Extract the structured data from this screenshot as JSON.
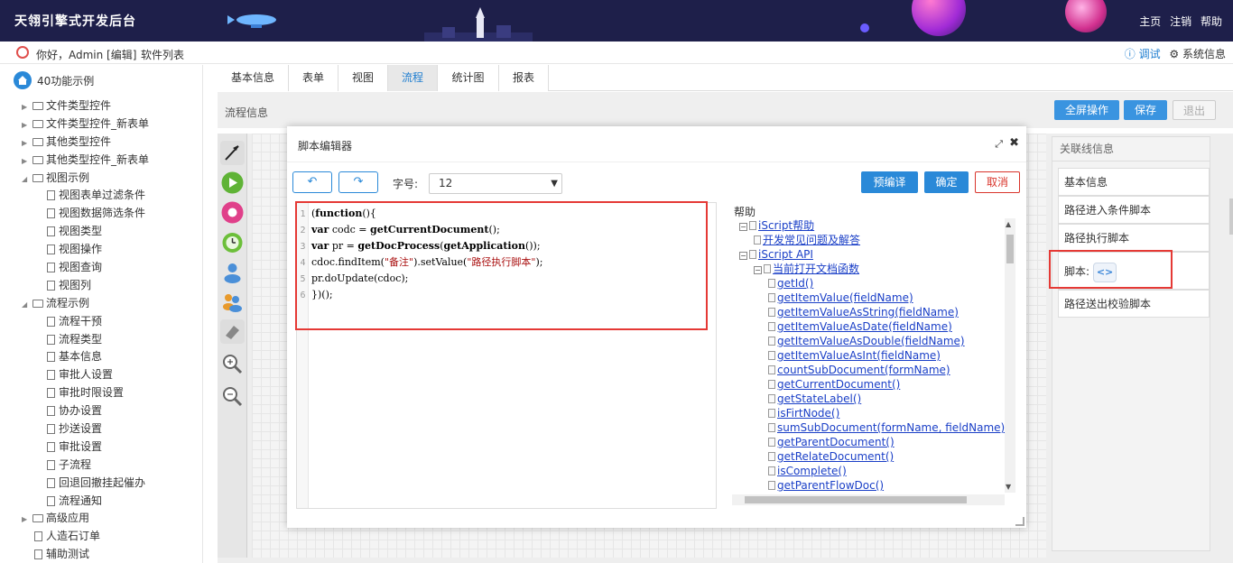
{
  "header": {
    "title": "天翎引擎式开发后台",
    "nav": [
      "主页",
      "注销",
      "帮助"
    ]
  },
  "userbar": {
    "greeting": "你好，Admin [编辑]",
    "software_list": "软件列表",
    "debug": "ⓘ 调试",
    "system_info": "⚙ 系统信息"
  },
  "sidebar": {
    "root": "40功能示例",
    "items": [
      {
        "label": "文件类型控件",
        "type": "folder",
        "level": 1,
        "expanded": false
      },
      {
        "label": "文件类型控件_新表单",
        "type": "folder",
        "level": 1,
        "expanded": false
      },
      {
        "label": "其他类型控件",
        "type": "folder",
        "level": 1,
        "expanded": false
      },
      {
        "label": "其他类型控件_新表单",
        "type": "folder",
        "level": 1,
        "expanded": false
      },
      {
        "label": "视图示例",
        "type": "folder",
        "level": 1,
        "expanded": true
      },
      {
        "label": "视图表单过滤条件",
        "type": "file",
        "level": 2
      },
      {
        "label": "视图数据筛选条件",
        "type": "file",
        "level": 2
      },
      {
        "label": "视图类型",
        "type": "file",
        "level": 2
      },
      {
        "label": "视图操作",
        "type": "file",
        "level": 2
      },
      {
        "label": "视图查询",
        "type": "file",
        "level": 2
      },
      {
        "label": "视图列",
        "type": "file",
        "level": 2
      },
      {
        "label": "流程示例",
        "type": "folder",
        "level": 1,
        "expanded": true
      },
      {
        "label": "流程干预",
        "type": "file",
        "level": 2
      },
      {
        "label": "流程类型",
        "type": "file",
        "level": 2
      },
      {
        "label": "基本信息",
        "type": "file",
        "level": 2
      },
      {
        "label": "审批人设置",
        "type": "file",
        "level": 2
      },
      {
        "label": "审批时限设置",
        "type": "file",
        "level": 2
      },
      {
        "label": "协办设置",
        "type": "file",
        "level": 2
      },
      {
        "label": "抄送设置",
        "type": "file",
        "level": 2
      },
      {
        "label": "审批设置",
        "type": "file",
        "level": 2
      },
      {
        "label": "子流程",
        "type": "file",
        "level": 2
      },
      {
        "label": "回退回撤挂起催办",
        "type": "file",
        "level": 2
      },
      {
        "label": "流程通知",
        "type": "file",
        "level": 2
      },
      {
        "label": "高级应用",
        "type": "folder",
        "level": 1,
        "expanded": false
      },
      {
        "label": "人造石订单",
        "type": "file",
        "level": 1
      },
      {
        "label": "辅助测试",
        "type": "file",
        "level": 1
      }
    ]
  },
  "tabs": [
    "基本信息",
    "表单",
    "视图",
    "流程",
    "统计图",
    "报表"
  ],
  "active_tab": "流程",
  "subbar": {
    "label": "流程信息",
    "fullscreen": "全屏操作",
    "save": "保存",
    "exit": "退出"
  },
  "right_panel": {
    "title": "关联线信息",
    "items": [
      "基本信息",
      "路径进入条件脚本",
      "路径执行脚本",
      "脚本:",
      "路径送出校验脚本"
    ],
    "script_icon": "<>"
  },
  "modal": {
    "title": "脚本编辑器",
    "maximize": "⤢",
    "close": "✖",
    "undo": "↶",
    "redo": "↷",
    "font_size_label": "字号:",
    "font_size_value": "12",
    "precompile": "预编译",
    "confirm": "确定",
    "cancel": "取消",
    "code_lines": [
      {
        "n": "1",
        "html": "(<b>function</b>(){"
      },
      {
        "n": "2",
        "html": "<b>var</b> codc = <b>getCurrentDocument</b>();"
      },
      {
        "n": "3",
        "html": "<b>var</b> pr = <b>getDocProcess</b>(<b>getApplication</b>());"
      },
      {
        "n": "4",
        "html": "cdoc.findItem(<span class='str'>\"备注\"</span>).setValue(<span class='str'>\"路径执行脚本\"</span>);"
      },
      {
        "n": "5",
        "html": "pr.doUpdate(cdoc);"
      },
      {
        "n": "6",
        "html": "})();"
      }
    ],
    "help": {
      "title": "帮助",
      "items": [
        {
          "label": "iScript帮助",
          "indent": 0,
          "kind": "minus"
        },
        {
          "label": "开发常见问题及解答",
          "indent": 1,
          "kind": "doc"
        },
        {
          "label": "iScript API",
          "indent": 0,
          "kind": "minus"
        },
        {
          "label": "当前打开文档函数",
          "indent": 1,
          "kind": "minus"
        },
        {
          "label": "getId()",
          "indent": 2,
          "kind": "doc"
        },
        {
          "label": "getItemValue(fieldName)",
          "indent": 2,
          "kind": "doc"
        },
        {
          "label": "getItemValueAsString(fieldName)",
          "indent": 2,
          "kind": "doc"
        },
        {
          "label": "getItemValueAsDate(fieldName)",
          "indent": 2,
          "kind": "doc"
        },
        {
          "label": "getItemValueAsDouble(fieldName)",
          "indent": 2,
          "kind": "doc"
        },
        {
          "label": "getItemValueAsInt(fieldName)",
          "indent": 2,
          "kind": "doc"
        },
        {
          "label": "countSubDocument(formName)",
          "indent": 2,
          "kind": "doc"
        },
        {
          "label": "getCurrentDocument()",
          "indent": 2,
          "kind": "doc"
        },
        {
          "label": "getStateLabel()",
          "indent": 2,
          "kind": "doc"
        },
        {
          "label": "isFirtNode()",
          "indent": 2,
          "kind": "doc"
        },
        {
          "label": "sumSubDocument(formName, fieldName)",
          "indent": 2,
          "kind": "doc"
        },
        {
          "label": "getParentDocument()",
          "indent": 2,
          "kind": "doc"
        },
        {
          "label": "getRelateDocument()",
          "indent": 2,
          "kind": "doc"
        },
        {
          "label": "isComplete()",
          "indent": 2,
          "kind": "doc"
        },
        {
          "label": "getParentFlowDoc()",
          "indent": 2,
          "kind": "doc"
        }
      ]
    }
  },
  "colors": {
    "header_bg": "#1e1f4a",
    "primary": "#2a89d8",
    "highlight_border": "#e53935",
    "link": "#1a3fc7"
  },
  "tool_icons": [
    "pointer-icon",
    "start-node-icon",
    "end-node-icon",
    "timer-node-icon",
    "user-node-icon",
    "multi-user-node-icon",
    "eraser-icon",
    "zoom-in-icon",
    "zoom-out-icon"
  ]
}
